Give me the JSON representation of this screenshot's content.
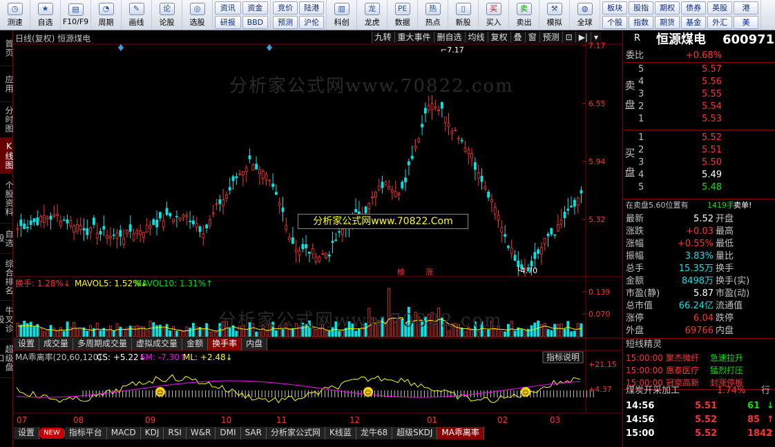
{
  "toolbar": {
    "tools": [
      {
        "label": "测速",
        "icon": "speed-icon"
      },
      {
        "label": "自选",
        "icon": "star-icon"
      },
      {
        "label": "F10/F9",
        "icon": "f10-icon"
      },
      {
        "label": "周期",
        "icon": "clock-icon"
      },
      {
        "label": "画线",
        "icon": "pencil-icon"
      },
      {
        "label": "论股",
        "icon": "lungu-icon"
      },
      {
        "label": "选股",
        "icon": "select-stock-icon"
      }
    ],
    "group1": [
      "资讯",
      "资金",
      "研报",
      "BBD"
    ],
    "group2": [
      "竞价",
      "陆港",
      "预测",
      "沪伦"
    ],
    "tools2": [
      {
        "label": "科创",
        "icon": "kechuang-icon"
      },
      {
        "label": "龙虎",
        "icon": "dragon-tiger-icon"
      },
      {
        "label": "数据",
        "icon": "data-icon"
      },
      {
        "label": "热点",
        "icon": "hot-icon"
      },
      {
        "label": "新股",
        "icon": "newstock-icon"
      },
      {
        "label": "买入",
        "icon": "buy-icon"
      },
      {
        "label": "卖出",
        "icon": "sell-icon"
      },
      {
        "label": "模拟",
        "icon": "simulate-icon"
      },
      {
        "label": "全球",
        "icon": "globe-icon"
      }
    ],
    "group3": [
      "板块",
      "股指",
      "期权",
      "债券",
      "英股",
      "港",
      "个股",
      "指数",
      "期货",
      "基金",
      "外汇",
      "美"
    ]
  },
  "leftbar": [
    "首页",
    "应用",
    "分时图",
    "K线图",
    "个股资料",
    "自选股",
    "综合排名",
    "牛叉诊股",
    "超级盘口"
  ],
  "chart": {
    "title": "日线(复权) 恒源煤电",
    "tabs": [
      "九转",
      "重大事件",
      "删自选",
      "均线",
      "复权",
      "叠",
      "窗",
      "预测"
    ],
    "price_labels": [
      "7.17",
      "6.55",
      "5.94",
      "5.32"
    ],
    "high_mark": "7.17",
    "low_mark": "4.70",
    "markers": [
      "榜",
      "涨"
    ],
    "vol_legend": {
      "a": "换手: 1.28%↓",
      "b": "MAVOL5: 1.52%↓",
      "c": "MAVOL10: 1.31%↑"
    },
    "vol_labels": [
      "0.139",
      "0.070"
    ],
    "vol_tabs": [
      "设置",
      "成交量",
      "多周期成交量",
      "虚拟成交量",
      "金额",
      "换手率",
      "内盘"
    ],
    "ind_legend": {
      "a": "MA乖离率(20,60,120)",
      "b": "CS: +5.22↓",
      "c": "SM: -7.30↑",
      "d": "ML: +2.48↓"
    },
    "ind_button": "指标说明",
    "ind_labels": [
      "+21.15",
      "+4.37"
    ],
    "months": [
      "07",
      "08",
      "09",
      "10",
      "11",
      "12",
      "01",
      "02",
      "03"
    ],
    "bottom_tabs": [
      "设置",
      "NEW",
      "指标平台",
      "MACD",
      "KDJ",
      "RSI",
      "W&R",
      "DMI",
      "SAR",
      "分析家公式网",
      "K线蓝",
      "龙牛68",
      "超级SKDJ",
      "MA乖离率"
    ],
    "watermark": "分析家公式网www.70822.com",
    "banner": "分析家公式网www.70822.Com"
  },
  "panel": {
    "r": "R",
    "name": "恒源煤电",
    "code": "600971",
    "weibi_label": "委比",
    "weibi": "+0.68%",
    "sell_label": "卖盘",
    "buy_label": "买盘",
    "sell": [
      [
        "5",
        "5.57"
      ],
      [
        "4",
        "5.56"
      ],
      [
        "3",
        "5.55"
      ],
      [
        "2",
        "5.54"
      ],
      [
        "1",
        "5.53"
      ]
    ],
    "buy": [
      [
        "1",
        "5.52"
      ],
      [
        "2",
        "5.51"
      ],
      [
        "3",
        "5.50"
      ],
      [
        "4",
        "5.49"
      ],
      [
        "5",
        "5.48"
      ]
    ],
    "notice": "在卖盘5.60位置有",
    "notice_vol": "1419手",
    "notice_end": "卖单!",
    "stats": [
      [
        "最新",
        "5.52",
        "开盘"
      ],
      [
        "涨跌",
        "+0.03",
        "最高"
      ],
      [
        "涨幅",
        "+0.55%",
        "最低"
      ],
      [
        "振幅",
        "3.83%",
        "量比"
      ],
      [
        "总手",
        "15.35万",
        "换手"
      ],
      [
        "金额",
        "8498万",
        "换手(实)"
      ],
      [
        "市盈(静)",
        "5.87",
        "市盈(动)"
      ],
      [
        "总市值",
        "66.24亿",
        "流通值"
      ],
      [
        "涨停",
        "6.04",
        "跌停"
      ],
      [
        "外盘",
        "69766",
        "内盘"
      ]
    ],
    "sprite_title": "短线精灵",
    "sprites": [
      [
        "15:00:00",
        "聚杰微纤",
        "急速拉升"
      ],
      [
        "15:00:00",
        "惠泰医疗",
        "猛烈打压"
      ],
      [
        "15:00:00",
        "冠豪高新",
        "封涨停板"
      ]
    ],
    "sector": "煤炭开采加工",
    "sector_pct": "1.74%",
    "trades_title": "行",
    "ticks": [
      [
        "14:56",
        "5.51",
        "61",
        "down"
      ],
      [
        "14:56",
        "5.52",
        "85",
        "up"
      ],
      [
        "15:00",
        "5.52",
        "1842",
        "up"
      ]
    ]
  },
  "colors": {
    "up": "#ff3232",
    "down": "#00e6e6",
    "ma5": "#ffff00",
    "ma10": "#ff00ff"
  }
}
